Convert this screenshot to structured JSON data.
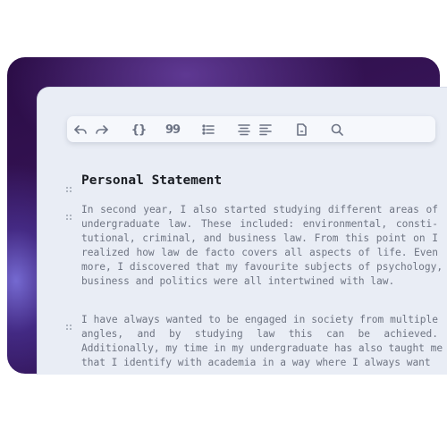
{
  "toolbar": {
    "buttons": [
      {
        "name": "undo-button",
        "icon": "undo-icon"
      },
      {
        "name": "redo-button",
        "icon": "redo-icon"
      },
      {
        "name": "code-button",
        "icon": "braces-icon",
        "glyph": "{}"
      },
      {
        "name": "quote-button",
        "icon": "quote-icon",
        "glyph": "99"
      },
      {
        "name": "bullet-list-button",
        "icon": "bullet-list-icon"
      },
      {
        "name": "align-center-button",
        "icon": "align-center-icon"
      },
      {
        "name": "align-left-button",
        "icon": "align-left-icon"
      },
      {
        "name": "document-button",
        "icon": "document-icon"
      },
      {
        "name": "search-button",
        "icon": "search-icon"
      }
    ],
    "code_glyph": "{}",
    "quote_glyph": "99"
  },
  "document": {
    "title": "Personal Statement",
    "paragraphs": [
      {
        "lines": [
          "In second year, I also started studying different areas of",
          "undergraduate law. These included: environmental, consti-",
          "tutional, criminal, and business law. From this point on I",
          "realized how law de facto covers all aspects of life. Even",
          "more, I discovered that my favourite subjects of psychology,",
          "business and politics were all intertwined with law."
        ]
      },
      {
        "lines": [
          "I have always wanted to be engaged in society from multiple",
          "angles, and by studying law this can be achieved.",
          "Additionally, my time in my undergraduate has also taught me",
          "that I identify with academia in a way where I always want"
        ]
      }
    ]
  },
  "colors": {
    "title": "#1a1d23",
    "body_text": "#6e7482",
    "editor_bg": "#e9edf5",
    "toolbar_bg": "#f6f8fc",
    "backdrop": "#2a0c45"
  }
}
